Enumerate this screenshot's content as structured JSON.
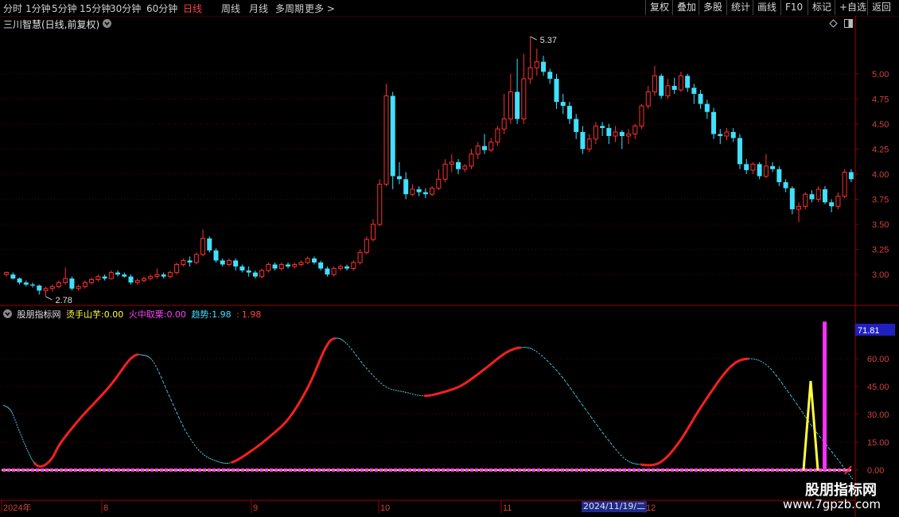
{
  "toolbar": {
    "periods": [
      "分时",
      "1分钟",
      "5分钟",
      "15分钟",
      "30分钟",
      "60分钟",
      "日线",
      "周线",
      "月线",
      "多周期",
      "更多 >"
    ],
    "active_period": "日线",
    "actions": [
      "复权",
      "叠加",
      "多股",
      "统计",
      "画线",
      "F10",
      "标记",
      "+自选",
      "返回"
    ]
  },
  "chart": {
    "stock_title": "三川智慧(日线,前复权)",
    "price_axis": [
      "5.00",
      "4.75",
      "4.50",
      "4.25",
      "4.00",
      "3.75",
      "3.50",
      "3.25",
      "3.00"
    ],
    "high_label": "5.37",
    "low_label": "2.78",
    "indicator": {
      "name": "股朋指标网",
      "line1_label": "烫手山芋:",
      "line1_value": "0.00",
      "line2_label": "火中取栗:",
      "line2_value": "0.00",
      "line3_label": "趋势:",
      "line3_value": "1.98",
      "line3_value2": "1.98",
      "current_value": "71.81",
      "axis": [
        "60.00",
        "45.00",
        "30.00",
        "15.00",
        "0.00"
      ]
    },
    "x_labels": [
      "2024年",
      "8",
      "9",
      "10",
      "11",
      "12"
    ],
    "date_highlight": "2024/11/19/二"
  },
  "chart_data": {
    "type": "candlestick",
    "title": "三川智慧(日线,前复权)",
    "ylim": [
      2.7,
      5.45
    ],
    "price_ticks": [
      3.0,
      3.25,
      3.5,
      3.75,
      4.0,
      4.25,
      4.5,
      4.75,
      5.0
    ],
    "high": 5.37,
    "low": 2.78,
    "candles": [
      [
        3.0,
        3.02,
        2.98,
        3.03
      ],
      [
        3.0,
        2.96,
        2.95,
        3.02
      ],
      [
        2.96,
        2.92,
        2.9,
        2.97
      ],
      [
        2.92,
        2.9,
        2.88,
        2.94
      ],
      [
        2.9,
        2.89,
        2.87,
        2.92
      ],
      [
        2.89,
        2.84,
        2.8,
        2.9
      ],
      [
        2.84,
        2.86,
        2.78,
        2.88
      ],
      [
        2.86,
        2.88,
        2.83,
        2.9
      ],
      [
        2.88,
        2.92,
        2.86,
        2.94
      ],
      [
        2.92,
        2.96,
        2.9,
        3.07
      ],
      [
        2.96,
        2.86,
        2.84,
        2.98
      ],
      [
        2.86,
        2.88,
        2.84,
        2.9
      ],
      [
        2.88,
        2.92,
        2.86,
        2.94
      ],
      [
        2.92,
        2.95,
        2.9,
        2.97
      ],
      [
        2.95,
        2.98,
        2.93,
        3.0
      ],
      [
        2.98,
        2.96,
        2.94,
        3.0
      ],
      [
        2.96,
        3.02,
        2.95,
        3.04
      ],
      [
        3.02,
        3.0,
        2.98,
        3.04
      ],
      [
        3.0,
        2.98,
        2.97,
        3.02
      ],
      [
        2.98,
        2.92,
        2.9,
        3.0
      ],
      [
        2.92,
        2.94,
        2.9,
        2.96
      ],
      [
        2.94,
        2.96,
        2.92,
        2.98
      ],
      [
        2.96,
        2.98,
        2.94,
        3.0
      ],
      [
        2.98,
        3.0,
        2.96,
        3.06
      ],
      [
        3.0,
        2.98,
        2.96,
        3.02
      ],
      [
        2.98,
        3.02,
        2.96,
        3.04
      ],
      [
        3.02,
        3.1,
        3.0,
        3.12
      ],
      [
        3.1,
        3.14,
        3.08,
        3.16
      ],
      [
        3.14,
        3.12,
        3.08,
        3.18
      ],
      [
        3.12,
        3.2,
        3.1,
        3.22
      ],
      [
        3.2,
        3.36,
        3.18,
        3.45
      ],
      [
        3.36,
        3.24,
        3.22,
        3.38
      ],
      [
        3.24,
        3.14,
        3.12,
        3.26
      ],
      [
        3.14,
        3.1,
        3.08,
        3.16
      ],
      [
        3.1,
        3.14,
        3.08,
        3.16
      ],
      [
        3.14,
        3.08,
        3.04,
        3.16
      ],
      [
        3.08,
        3.04,
        3.02,
        3.1
      ],
      [
        3.04,
        3.02,
        2.98,
        3.08
      ],
      [
        3.02,
        2.98,
        2.96,
        3.04
      ],
      [
        2.98,
        3.04,
        2.96,
        3.06
      ],
      [
        3.04,
        3.1,
        3.02,
        3.12
      ],
      [
        3.1,
        3.06,
        3.04,
        3.12
      ],
      [
        3.06,
        3.1,
        3.04,
        3.12
      ],
      [
        3.1,
        3.08,
        3.06,
        3.12
      ],
      [
        3.08,
        3.1,
        3.06,
        3.12
      ],
      [
        3.1,
        3.12,
        3.08,
        3.14
      ],
      [
        3.12,
        3.16,
        3.1,
        3.18
      ],
      [
        3.16,
        3.12,
        3.1,
        3.18
      ],
      [
        3.12,
        3.06,
        3.04,
        3.14
      ],
      [
        3.06,
        3.0,
        2.98,
        3.08
      ],
      [
        3.0,
        3.06,
        2.98,
        3.08
      ],
      [
        3.06,
        3.08,
        3.04,
        3.1
      ],
      [
        3.08,
        3.06,
        3.04,
        3.1
      ],
      [
        3.06,
        3.12,
        3.04,
        3.14
      ],
      [
        3.12,
        3.22,
        3.1,
        3.25
      ],
      [
        3.22,
        3.35,
        3.2,
        3.38
      ],
      [
        3.35,
        3.5,
        3.33,
        3.55
      ],
      [
        3.5,
        3.9,
        3.48,
        3.95
      ],
      [
        3.9,
        4.78,
        3.88,
        4.9
      ],
      [
        4.78,
        3.98,
        3.85,
        4.82
      ],
      [
        3.98,
        3.95,
        3.9,
        4.12
      ],
      [
        3.95,
        3.8,
        3.75,
        4.02
      ],
      [
        3.8,
        3.85,
        3.78,
        3.9
      ],
      [
        3.85,
        3.82,
        3.78,
        3.88
      ],
      [
        3.82,
        3.8,
        3.76,
        3.86
      ],
      [
        3.8,
        3.86,
        3.78,
        3.88
      ],
      [
        3.86,
        3.95,
        3.84,
        4.05
      ],
      [
        3.95,
        4.1,
        3.92,
        4.15
      ],
      [
        4.1,
        4.12,
        4.02,
        4.2
      ],
      [
        4.12,
        4.05,
        4.0,
        4.15
      ],
      [
        4.05,
        4.08,
        4.02,
        4.1
      ],
      [
        4.08,
        4.2,
        4.05,
        4.25
      ],
      [
        4.2,
        4.28,
        4.15,
        4.32
      ],
      [
        4.28,
        4.24,
        4.2,
        4.4
      ],
      [
        4.24,
        4.32,
        4.22,
        4.36
      ],
      [
        4.32,
        4.45,
        4.28,
        4.48
      ],
      [
        4.45,
        4.55,
        4.4,
        4.8
      ],
      [
        4.55,
        4.82,
        4.5,
        5.0
      ],
      [
        4.82,
        4.55,
        4.5,
        5.15
      ],
      [
        4.55,
        4.95,
        4.5,
        5.2
      ],
      [
        4.95,
        5.06,
        4.9,
        5.37
      ],
      [
        5.06,
        5.12,
        4.98,
        5.25
      ],
      [
        5.12,
        5.02,
        4.98,
        5.18
      ],
      [
        5.02,
        4.95,
        4.9,
        5.05
      ],
      [
        4.95,
        4.72,
        4.65,
        5.0
      ],
      [
        4.72,
        4.68,
        4.6,
        4.8
      ],
      [
        4.68,
        4.55,
        4.5,
        4.72
      ],
      [
        4.55,
        4.42,
        4.35,
        4.6
      ],
      [
        4.42,
        4.25,
        4.2,
        4.48
      ],
      [
        4.25,
        4.35,
        4.22,
        4.4
      ],
      [
        4.35,
        4.48,
        4.3,
        4.52
      ],
      [
        4.48,
        4.46,
        4.38,
        4.52
      ],
      [
        4.46,
        4.38,
        4.3,
        4.5
      ],
      [
        4.38,
        4.42,
        4.32,
        4.48
      ],
      [
        4.42,
        4.38,
        4.25,
        4.44
      ],
      [
        4.38,
        4.4,
        4.3,
        4.45
      ],
      [
        4.4,
        4.48,
        4.35,
        4.5
      ],
      [
        4.48,
        4.68,
        4.45,
        4.7
      ],
      [
        4.68,
        4.82,
        4.65,
        4.88
      ],
      [
        4.82,
        4.98,
        4.78,
        5.08
      ],
      [
        4.98,
        4.78,
        4.75,
        5.0
      ],
      [
        4.78,
        4.88,
        4.75,
        4.95
      ],
      [
        4.88,
        4.84,
        4.8,
        4.96
      ],
      [
        4.84,
        4.98,
        4.82,
        5.02
      ],
      [
        4.98,
        4.86,
        4.82,
        5.0
      ],
      [
        4.86,
        4.8,
        4.7,
        4.9
      ],
      [
        4.8,
        4.7,
        4.65,
        4.84
      ],
      [
        4.7,
        4.62,
        4.55,
        4.74
      ],
      [
        4.62,
        4.4,
        4.35,
        4.66
      ],
      [
        4.4,
        4.38,
        4.3,
        4.45
      ],
      [
        4.38,
        4.42,
        4.34,
        4.46
      ],
      [
        4.42,
        4.36,
        4.32,
        4.46
      ],
      [
        4.36,
        4.1,
        4.05,
        4.4
      ],
      [
        4.1,
        4.04,
        4.0,
        4.15
      ],
      [
        4.04,
        4.1,
        4.0,
        4.12
      ],
      [
        4.1,
        3.98,
        3.95,
        4.12
      ],
      [
        3.98,
        4.08,
        3.96,
        4.2
      ],
      [
        4.08,
        4.05,
        4.02,
        4.12
      ],
      [
        4.05,
        3.92,
        3.88,
        4.08
      ],
      [
        3.92,
        3.86,
        3.82,
        3.95
      ],
      [
        3.86,
        3.65,
        3.6,
        3.88
      ],
      [
        3.65,
        3.68,
        3.52,
        3.72
      ],
      [
        3.68,
        3.8,
        3.65,
        3.82
      ],
      [
        3.8,
        3.75,
        3.72,
        3.84
      ],
      [
        3.75,
        3.85,
        3.72,
        3.88
      ],
      [
        3.85,
        3.72,
        3.7,
        3.88
      ],
      [
        3.72,
        3.68,
        3.62,
        3.75
      ],
      [
        3.68,
        3.78,
        3.65,
        3.82
      ],
      [
        3.78,
        4.02,
        3.76,
        4.05
      ],
      [
        4.02,
        3.95,
        3.92,
        4.05
      ]
    ],
    "indicator": {
      "name": "股朋指标网",
      "current_value": 71.81,
      "ylim": [
        0,
        80
      ],
      "ticks": [
        0,
        15,
        30,
        45,
        60
      ],
      "trend_points": [
        [
          0,
          35
        ],
        [
          4,
          32
        ],
        [
          8,
          22
        ],
        [
          12,
          12
        ],
        [
          16,
          4
        ],
        [
          20,
          2
        ],
        [
          25,
          6
        ],
        [
          30,
          15
        ],
        [
          40,
          28
        ],
        [
          55,
          45
        ],
        [
          66,
          60
        ],
        [
          72,
          62
        ],
        [
          78,
          58
        ],
        [
          86,
          40
        ],
        [
          94,
          22
        ],
        [
          102,
          10
        ],
        [
          110,
          5
        ],
        [
          118,
          4
        ],
        [
          128,
          10
        ],
        [
          138,
          18
        ],
        [
          148,
          28
        ],
        [
          158,
          45
        ],
        [
          167,
          66
        ],
        [
          172,
          71
        ],
        [
          178,
          68
        ],
        [
          188,
          55
        ],
        [
          198,
          45
        ],
        [
          208,
          42
        ],
        [
          218,
          40
        ],
        [
          228,
          42
        ],
        [
          238,
          46
        ],
        [
          250,
          55
        ],
        [
          260,
          63
        ],
        [
          268,
          66
        ],
        [
          276,
          64
        ],
        [
          288,
          52
        ],
        [
          300,
          35
        ],
        [
          312,
          18
        ],
        [
          322,
          6
        ],
        [
          330,
          3
        ],
        [
          340,
          4
        ],
        [
          350,
          15
        ],
        [
          362,
          35
        ],
        [
          376,
          55
        ],
        [
          386,
          60
        ],
        [
          396,
          56
        ],
        [
          408,
          40
        ],
        [
          420,
          22
        ],
        [
          432,
          6
        ],
        [
          440,
          -5
        ]
      ],
      "rising_segments": [
        [
          16,
          70
        ],
        [
          118,
          172
        ],
        [
          218,
          268
        ],
        [
          330,
          386
        ]
      ],
      "spike_yellow": 48,
      "spike_magenta": 80
    }
  }
}
